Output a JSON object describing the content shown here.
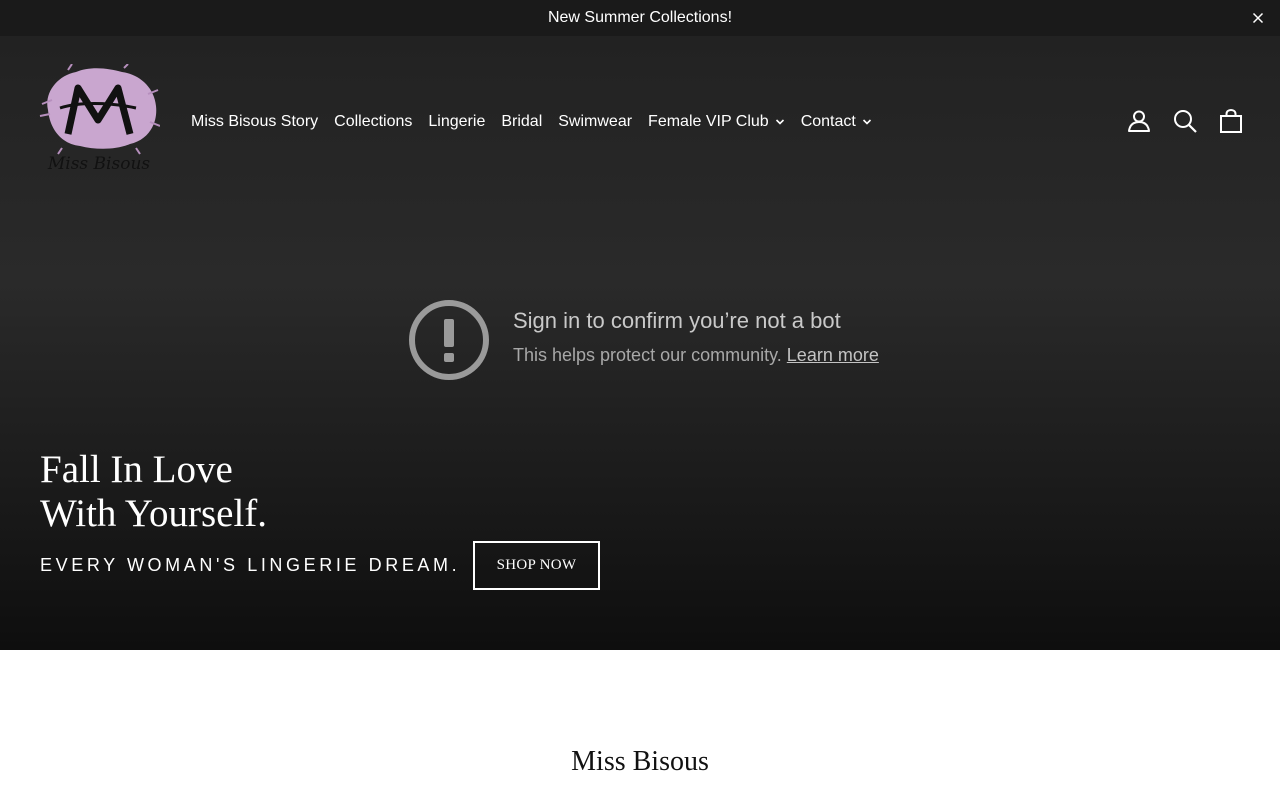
{
  "announcement": {
    "text": "New Summer Collections!"
  },
  "brand": {
    "logo_script": "Miss Bisous",
    "logo_color": "#c9a6cf"
  },
  "nav": {
    "items": [
      {
        "label": "Miss Bisous Story",
        "has_dropdown": false
      },
      {
        "label": "Collections",
        "has_dropdown": false
      },
      {
        "label": "Lingerie",
        "has_dropdown": false
      },
      {
        "label": "Bridal",
        "has_dropdown": false
      },
      {
        "label": "Swimwear",
        "has_dropdown": false
      },
      {
        "label": "Female VIP Club",
        "has_dropdown": true
      },
      {
        "label": "Contact",
        "has_dropdown": true
      }
    ]
  },
  "header_icons": [
    "account-icon",
    "search-icon",
    "cart-icon"
  ],
  "bot_notice": {
    "title": "Sign in to confirm you’re not a bot",
    "subtitle": "This helps protect our community.",
    "link": "Learn more"
  },
  "hero": {
    "heading_line1": "Fall In Love",
    "heading_line2": "With Yourself.",
    "subheading": "EVERY WOMAN'S LINGERIE DREAM.",
    "cta": "SHOP NOW"
  },
  "section": {
    "title": "Miss Bisous"
  }
}
